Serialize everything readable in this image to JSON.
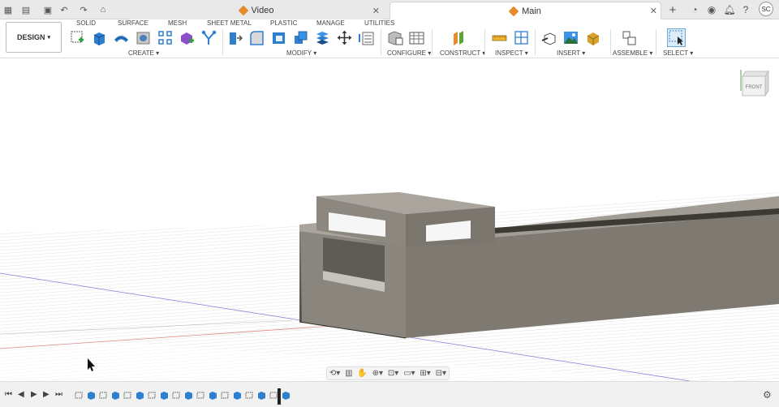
{
  "tabs": [
    {
      "label": "Video",
      "active": false
    },
    {
      "label": "Main",
      "active": true
    }
  ],
  "workspace": {
    "label": "DESIGN"
  },
  "mode_tabs": [
    "SOLID",
    "SURFACE",
    "MESH",
    "SHEET METAL",
    "PLASTIC",
    "MANAGE",
    "UTILITIES"
  ],
  "groups": [
    "CREATE",
    "MODIFY",
    "CONFIGURE",
    "CONSTRUCT",
    "INSPECT",
    "INSERT",
    "ASSEMBLE",
    "SELECT"
  ],
  "avatar": "SC",
  "viewcube": {
    "label": "FRONT"
  },
  "colors": {
    "accent": "#0696d7",
    "body": "#8a857d",
    "body_dark": "#6f6a63",
    "grid": "#d7d7d7"
  }
}
